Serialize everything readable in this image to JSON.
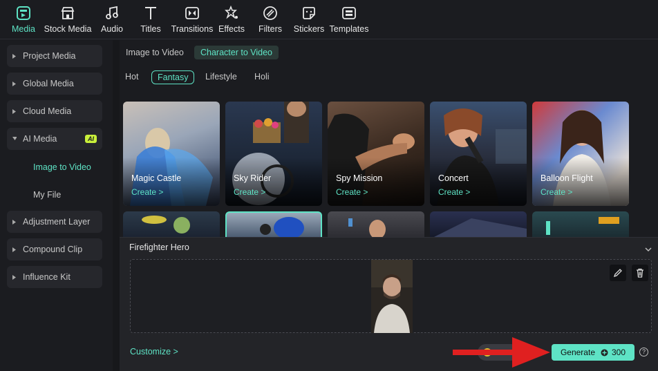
{
  "toolbar": {
    "tabs": [
      {
        "label": "Media",
        "icon": "media-icon",
        "active": true
      },
      {
        "label": "Stock Media",
        "icon": "stock-media-icon"
      },
      {
        "label": "Audio",
        "icon": "music-note-icon"
      },
      {
        "label": "Titles",
        "icon": "titles-icon"
      },
      {
        "label": "Transitions",
        "icon": "transitions-icon"
      },
      {
        "label": "Effects",
        "icon": "effects-icon"
      },
      {
        "label": "Filters",
        "icon": "filters-icon"
      },
      {
        "label": "Stickers",
        "icon": "stickers-icon"
      },
      {
        "label": "Templates",
        "icon": "templates-icon"
      }
    ]
  },
  "sidebar": {
    "items": [
      {
        "label": "Project Media"
      },
      {
        "label": "Global Media"
      },
      {
        "label": "Cloud Media"
      },
      {
        "label": "AI Media",
        "badge": "AI",
        "expanded": true
      },
      {
        "label": "Adjustment Layer"
      },
      {
        "label": "Compound Clip"
      },
      {
        "label": "Influence Kit"
      }
    ],
    "sub_items": [
      {
        "label": "Image to Video",
        "active": true
      },
      {
        "label": "My File"
      }
    ]
  },
  "content": {
    "modes": [
      {
        "label": "Image to Video"
      },
      {
        "label": "Character to Video",
        "selected": true
      }
    ],
    "tags": [
      {
        "label": "Hot"
      },
      {
        "label": "Fantasy",
        "selected": true
      },
      {
        "label": "Lifestyle"
      },
      {
        "label": "Holi"
      }
    ],
    "cards": [
      {
        "title": "Magic Castle",
        "action": "Create >"
      },
      {
        "title": "Sky Rider",
        "action": "Create >"
      },
      {
        "title": "Spy Mission",
        "action": "Create >"
      },
      {
        "title": "Concert",
        "action": "Create >"
      },
      {
        "title": "Balloon Flight",
        "action": "Create >"
      }
    ]
  },
  "panel": {
    "title": "Firefighter Hero",
    "customize": "Customize >",
    "generate": {
      "label": "Generate",
      "credits": "300"
    },
    "help": "?"
  },
  "colors": {
    "accent": "#5ee3c5",
    "background": "#1b1c20",
    "annotation_arrow": "#e02020"
  }
}
